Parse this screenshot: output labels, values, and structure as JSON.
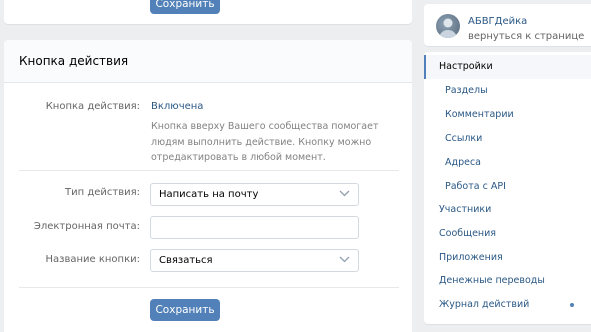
{
  "top_card": {
    "save_label": "Сохранить"
  },
  "action_section": {
    "title": "Кнопка действия",
    "status_label": "Кнопка действия:",
    "status_value": "Включена",
    "hint": "Кнопка вверху Вашего сообщества помогает людям выполнить действие. Кнопку можно отредактировать в любой момент.",
    "type_label": "Тип действия:",
    "type_value": "Написать на почту",
    "email_label": "Электронная почта:",
    "email_value": "",
    "button_name_label": "Название кнопки:",
    "button_name_value": "Связаться",
    "save_label": "Сохранить"
  },
  "sidebar": {
    "group_name": "АБВГДейка",
    "back_link": "вернуться к странице",
    "menu": [
      {
        "label": "Настройки",
        "active": true
      },
      {
        "label": "Разделы"
      },
      {
        "label": "Комментарии"
      },
      {
        "label": "Ссылки"
      },
      {
        "label": "Адреса"
      },
      {
        "label": "Работа с API"
      },
      {
        "label": "Участники"
      },
      {
        "label": "Сообщения"
      },
      {
        "label": "Приложения"
      },
      {
        "label": "Денежные переводы"
      },
      {
        "label": "Журнал действий"
      }
    ]
  },
  "colors": {
    "accent": "#5181b8",
    "link": "#2a5885",
    "background": "#edeef0"
  }
}
